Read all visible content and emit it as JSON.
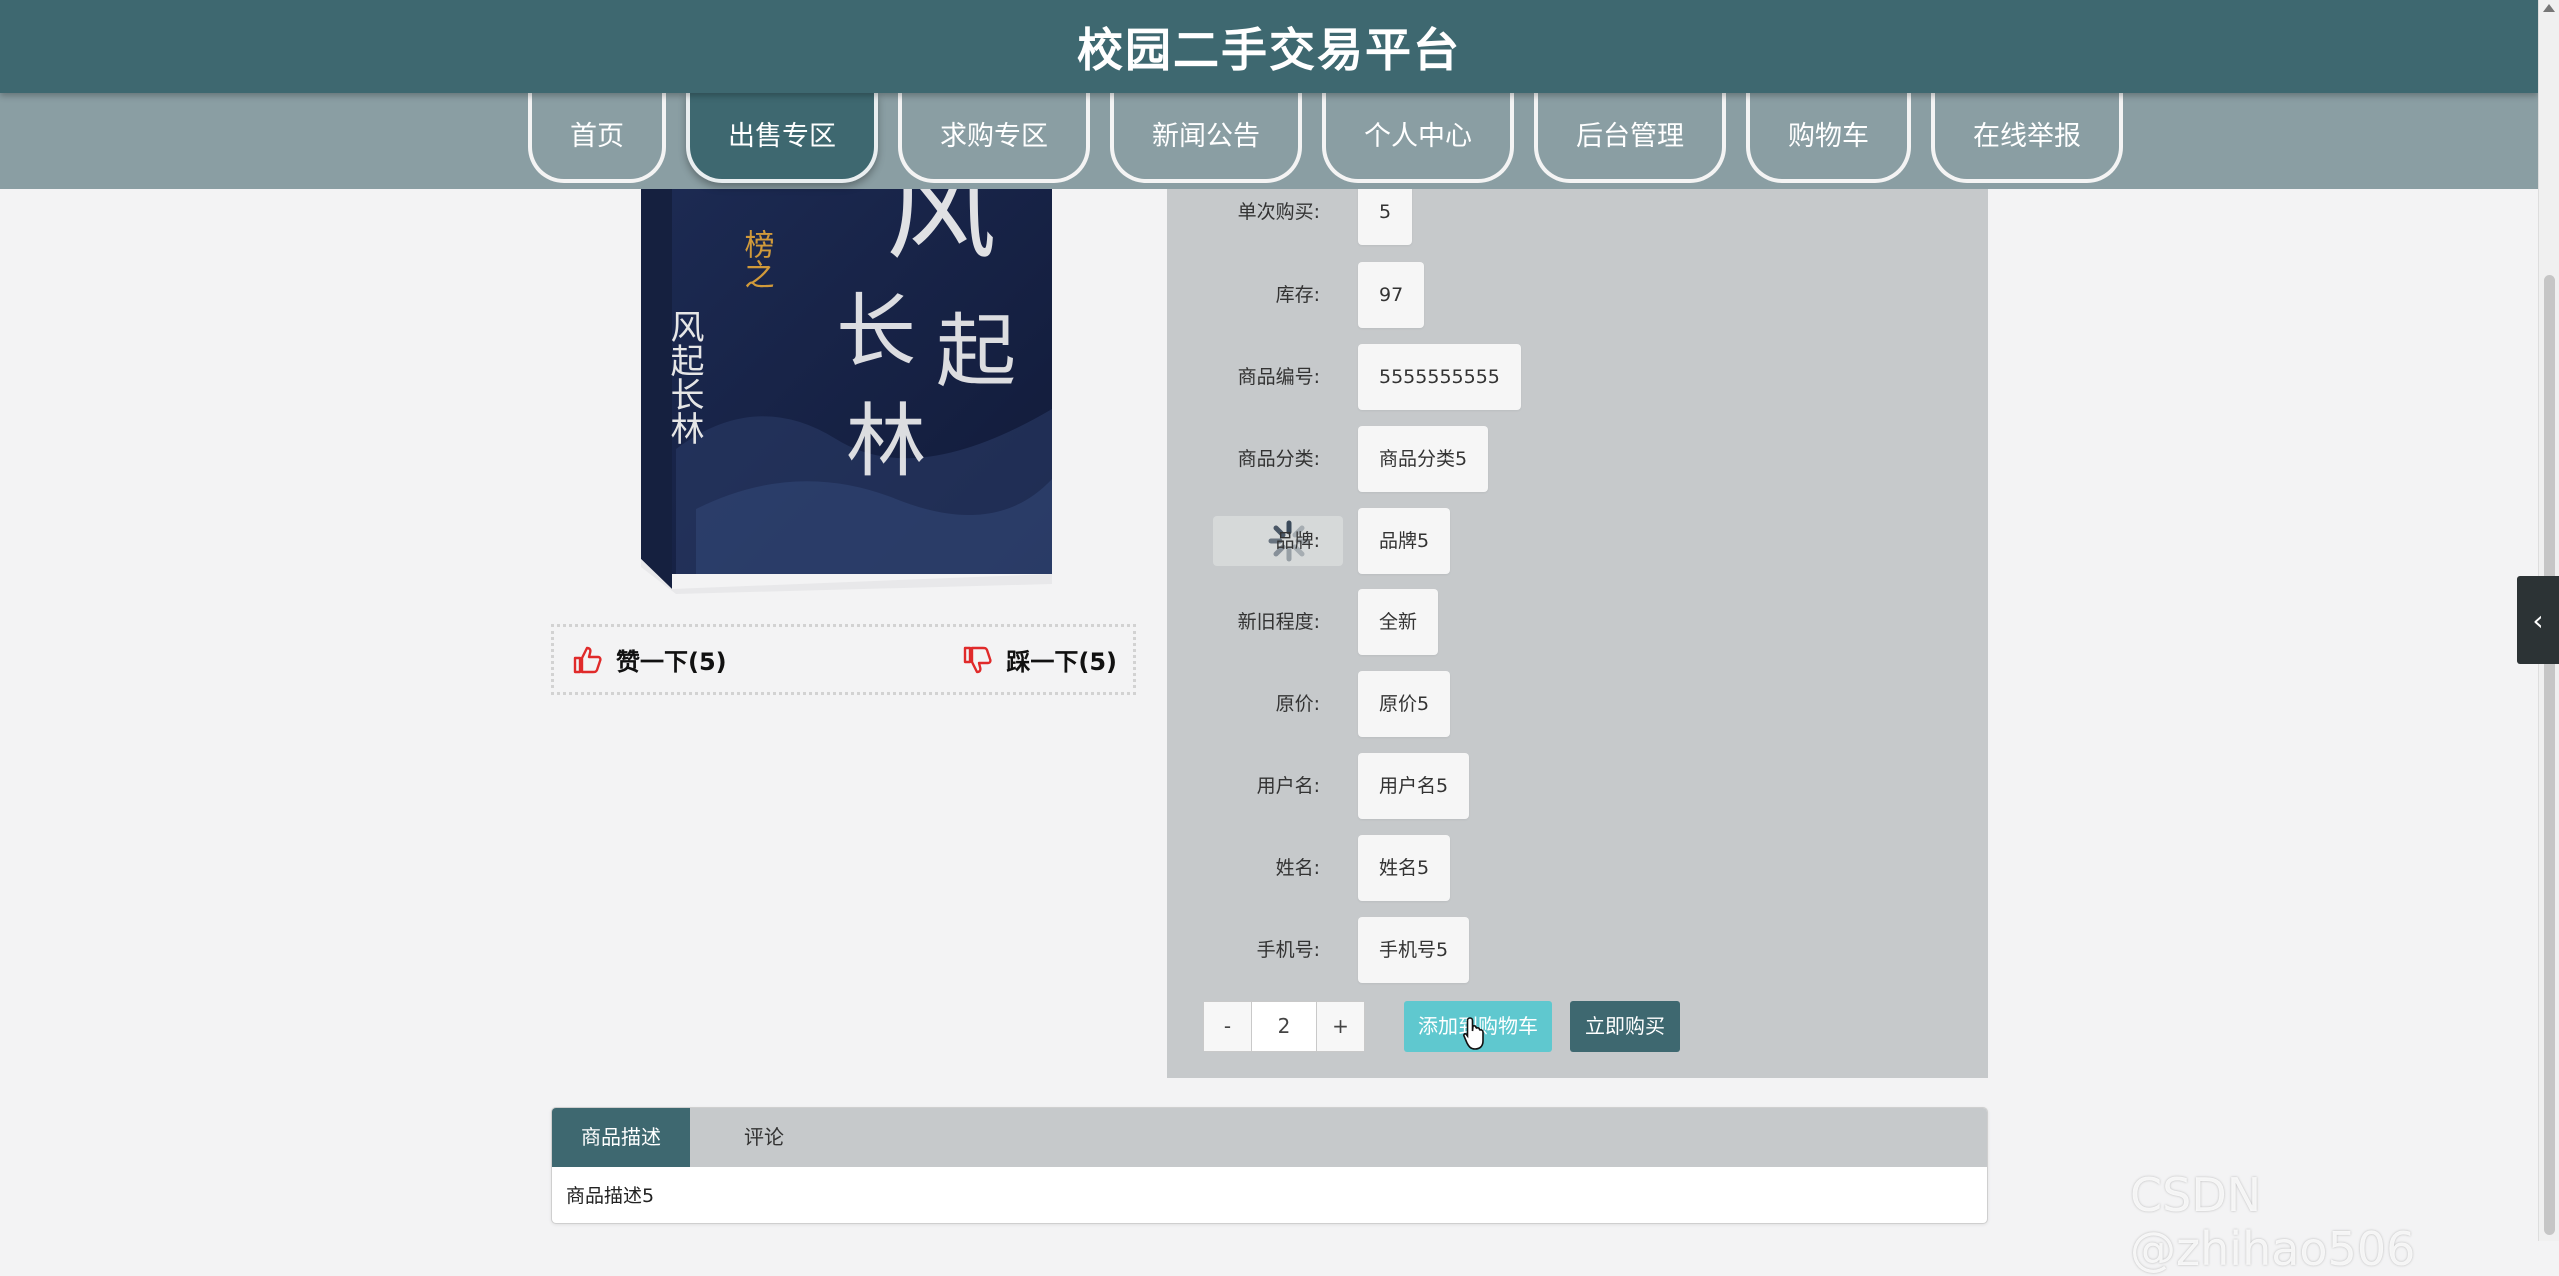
{
  "header": {
    "title": "校园二手交易平台"
  },
  "nav": {
    "items": [
      "首页",
      "出售专区",
      "求购专区",
      "新闻公告",
      "个人中心",
      "后台管理",
      "购物车",
      "在线举报"
    ],
    "active_index": 1
  },
  "votes": {
    "like": "赞一下(5)",
    "dislike": "踩一下(5)"
  },
  "details": [
    {
      "label": "单次购买:",
      "value": "5"
    },
    {
      "label": "库存:",
      "value": "97"
    },
    {
      "label": "商品编号:",
      "value": "5555555555"
    },
    {
      "label": "商品分类:",
      "value": "商品分类5"
    },
    {
      "label": "品牌:",
      "value": "品牌5"
    },
    {
      "label": "新旧程度:",
      "value": "全新"
    },
    {
      "label": "原价:",
      "value": "原价5"
    },
    {
      "label": "用户名:",
      "value": "用户名5"
    },
    {
      "label": "姓名:",
      "value": "姓名5"
    },
    {
      "label": "手机号:",
      "value": "手机号5"
    }
  ],
  "quantity": {
    "minus": "-",
    "value": "2",
    "plus": "+"
  },
  "actions": {
    "add_to_cart": "添加到购物车",
    "buy_now": "立即购买"
  },
  "tabs": {
    "items": [
      "商品描述",
      "评论"
    ],
    "content": "商品描述5"
  },
  "watermark": "CSDN @zhihao506",
  "colors": {
    "primary": "#3e6870",
    "nav_bg": "#8a9ea3",
    "cart_btn": "#5fc8cf",
    "panel": "#c6c9cb"
  }
}
